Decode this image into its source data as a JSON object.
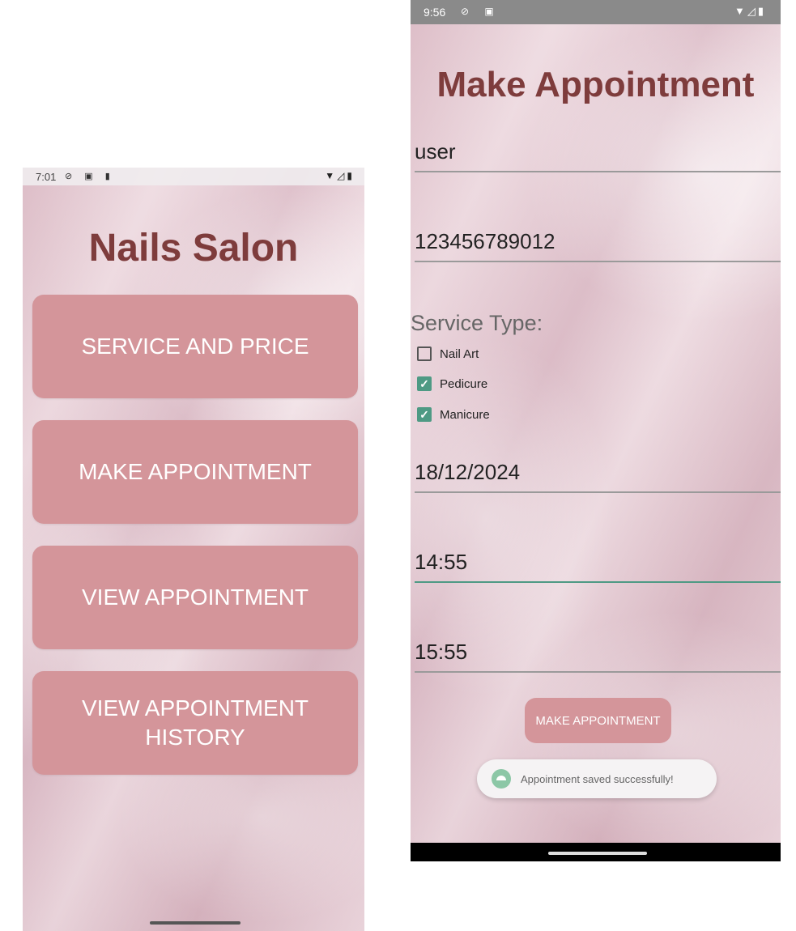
{
  "home_screen": {
    "status_bar": {
      "time": "7:01",
      "left_icons": "⊘ ▣ ▮",
      "right_icons": "▼◿▮"
    },
    "title": "Nails Salon",
    "buttons": [
      {
        "label": "SERVICE AND PRICE"
      },
      {
        "label": "MAKE APPOINTMENT"
      },
      {
        "label": "VIEW APPOINTMENT"
      },
      {
        "label": "VIEW APPOINTMENT HISTORY"
      }
    ]
  },
  "appointment_screen": {
    "status_bar": {
      "time": "9:56",
      "left_icons": "⊘ ▣",
      "right_icons": "▼◿▮"
    },
    "title": "Make Appointment",
    "fields": {
      "name": "user",
      "phone": "123456789012",
      "date": "18/12/2024",
      "start_time": "14:55",
      "end_time": "15:55"
    },
    "service_type_label": "Service Type:",
    "services": [
      {
        "label": "Nail Art",
        "checked": false
      },
      {
        "label": "Pedicure",
        "checked": true
      },
      {
        "label": "Manicure",
        "checked": true
      }
    ],
    "submit_label": "MAKE APPOINTMENT",
    "toast": {
      "message": "Appointment saved successfully!"
    }
  },
  "colors": {
    "title": "#7e3c3c",
    "button": "#d4959a",
    "accent": "#4e9a84"
  }
}
